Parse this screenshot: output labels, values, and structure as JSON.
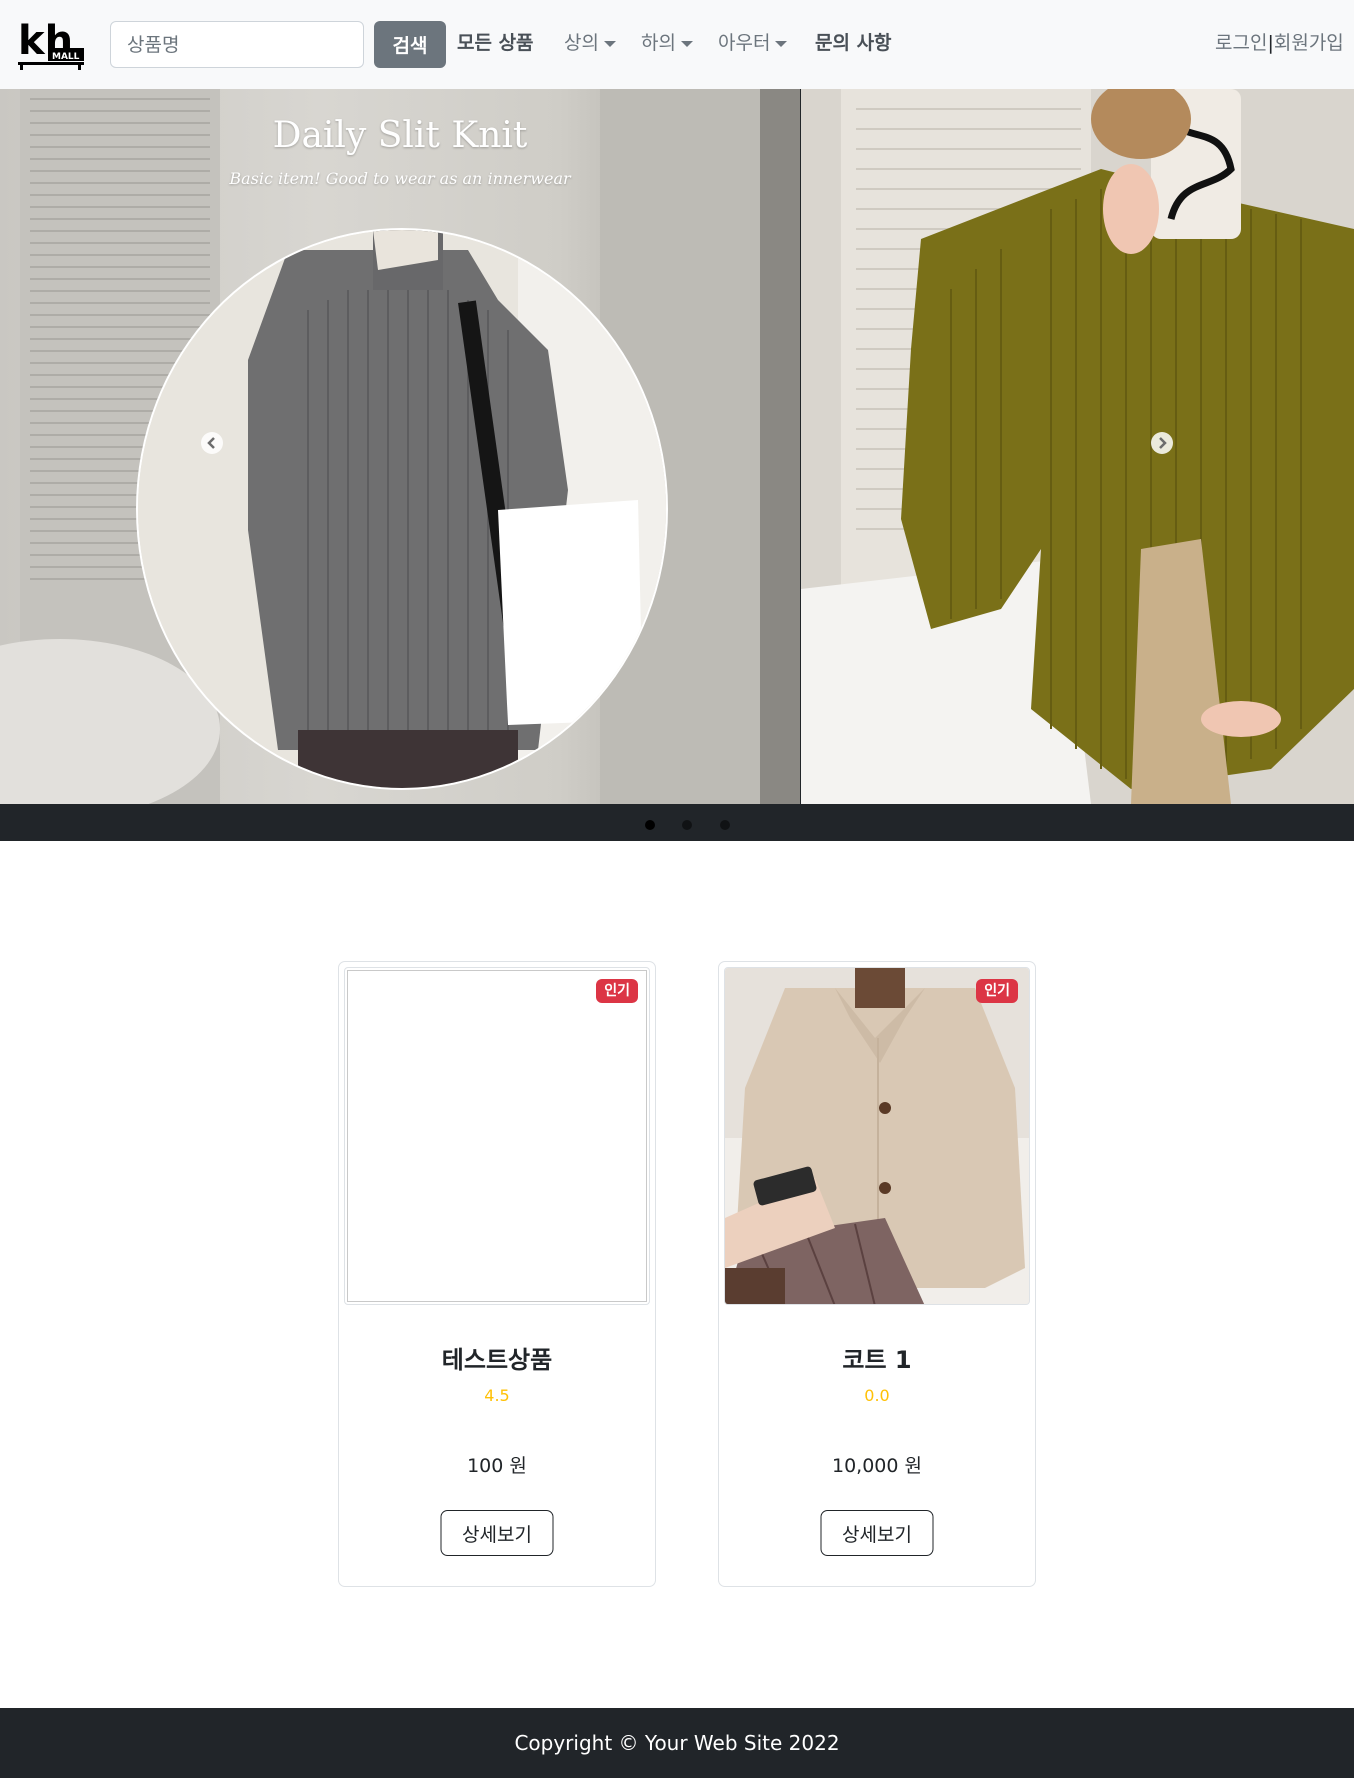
{
  "header": {
    "logo_text": "kh",
    "logo_sub": "MALL",
    "search": {
      "placeholder": "상품명",
      "value": "",
      "button_label": "검색"
    },
    "nav": {
      "all_products": "모든 상품",
      "tops": "상의",
      "bottoms": "하의",
      "outerwear": "아우터",
      "inquiry": "문의 사항"
    },
    "auth": {
      "login": "로그인",
      "separator": "|",
      "signup": "회원가입"
    }
  },
  "carousel": {
    "title": "Daily Slit Knit",
    "subtitle": "Basic item! Good to wear as an innerwear",
    "active_index": 0,
    "indicator_count": 3
  },
  "products": [
    {
      "badge": "인기",
      "name": "테스트상품",
      "rating": "4.5",
      "price": "100 원",
      "button": "상세보기"
    },
    {
      "badge": "인기",
      "name": "코트 1",
      "rating": "0.0",
      "price": "10,000 원",
      "button": "상세보기"
    }
  ],
  "footer": {
    "copyright": "Copyright © Your Web Site 2022"
  },
  "colors": {
    "navbar_bg": "#f8f9fa",
    "search_button": "#6c757d",
    "badge": "#dc3545",
    "rating": "#ffc107",
    "footer_bg": "#212529",
    "knit_grey": "#6f6f70",
    "knit_olive": "#7a7018",
    "coat_beige": "#d9c8b4"
  }
}
